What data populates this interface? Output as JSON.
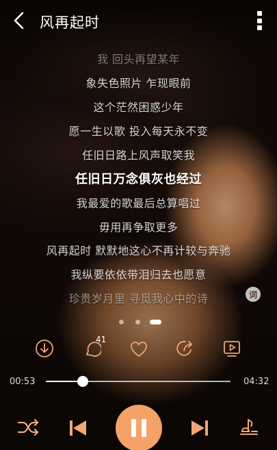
{
  "header": {
    "title": "风再起时"
  },
  "lyrics": [
    {
      "text": "我 回头再望某年",
      "state": "faded-top"
    },
    {
      "text": "象失色照片 乍现眼前",
      "state": "normal"
    },
    {
      "text": "这个茫然困惑少年",
      "state": "normal"
    },
    {
      "text": "愿一生以歌 投入每天永不变",
      "state": "normal"
    },
    {
      "text": "任旧日路上风声取笑我",
      "state": "normal"
    },
    {
      "text": "任旧日万念俱灰也经过",
      "state": "current"
    },
    {
      "text": "我最爱的歌最后总算唱过",
      "state": "normal"
    },
    {
      "text": "毋用再争取更多",
      "state": "normal"
    },
    {
      "text": "风再起时 默默地这心不再计较与奔驰",
      "state": "normal"
    },
    {
      "text": "我纵要依依带泪归去也愿意",
      "state": "normal"
    },
    {
      "text": "珍贵岁月里 寻觅我心中的诗",
      "state": "faded-bottom"
    }
  ],
  "lyric_badge": "词",
  "pager": {
    "count": 3,
    "active_index": 2
  },
  "actions": {
    "comment_count": "41"
  },
  "playback": {
    "elapsed": "00:53",
    "duration": "04:32",
    "progress_fraction": 0.2
  },
  "colors": {
    "accent": "#f4a268",
    "icon_accent": "#f0a878"
  },
  "icons": [
    "back-arrow-icon",
    "more-vertical-icon",
    "download-icon",
    "comment-icon",
    "heart-icon",
    "share-icon",
    "video-icon",
    "shuffle-icon",
    "previous-icon",
    "pause-icon",
    "next-icon",
    "sound-effect-icon"
  ]
}
